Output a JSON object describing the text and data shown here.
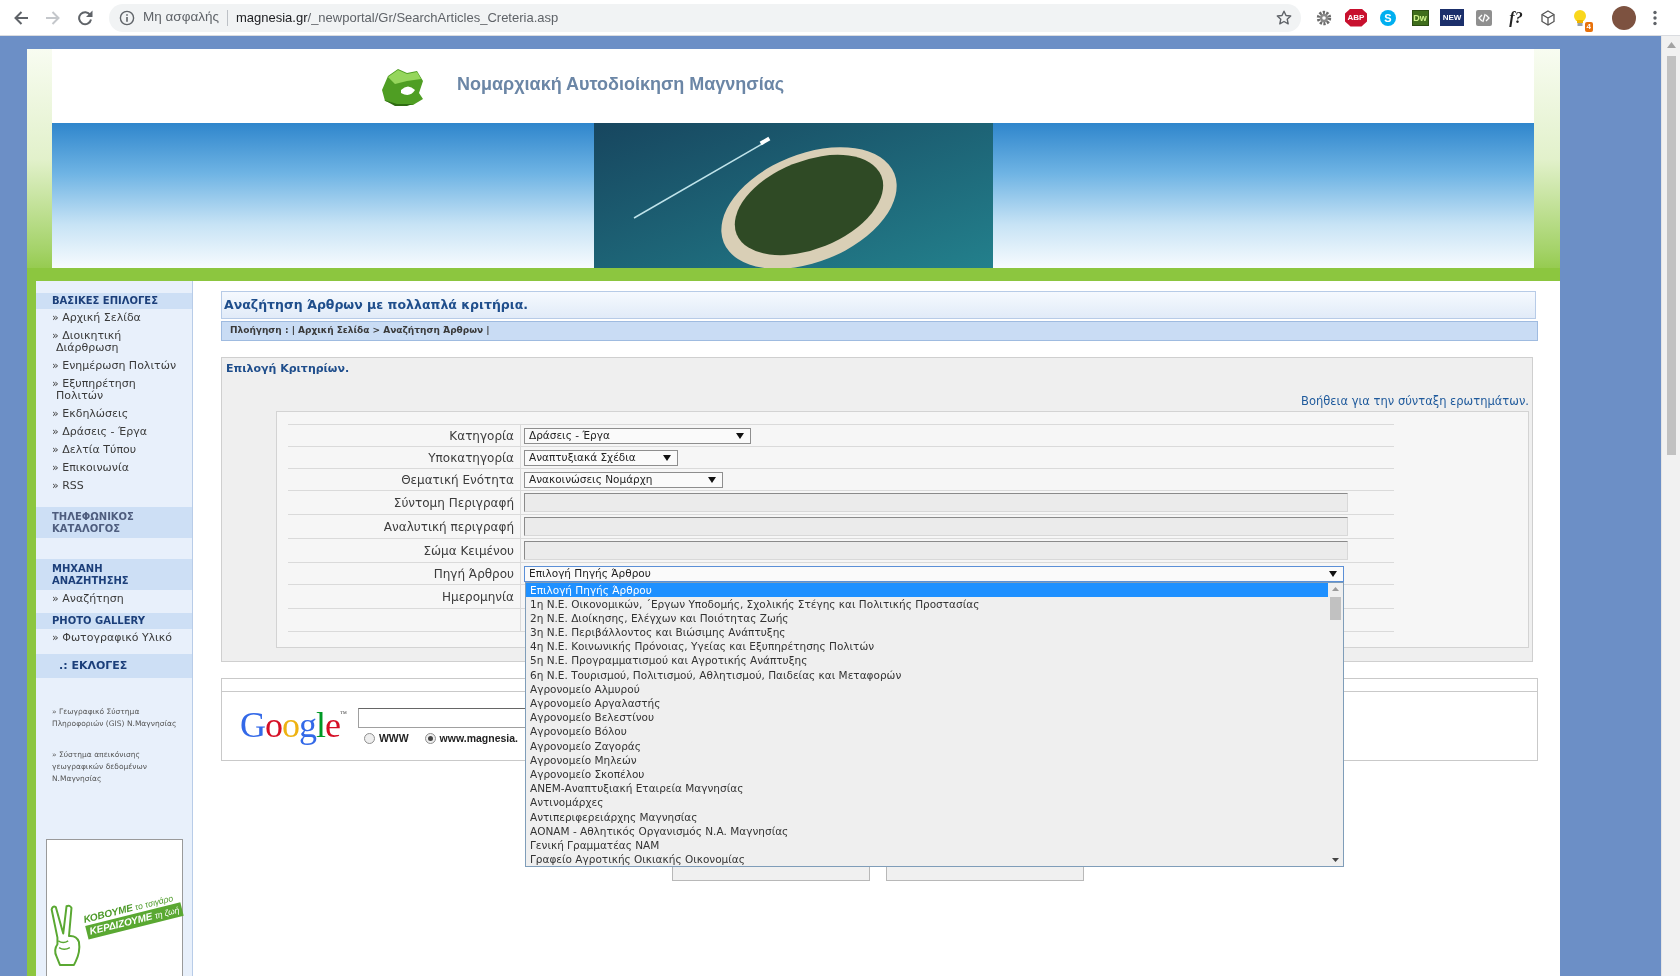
{
  "browser": {
    "nav": [
      {
        "kind": "back",
        "disabled": false
      },
      {
        "kind": "forward",
        "disabled": true
      },
      {
        "kind": "reload",
        "disabled": false
      }
    ],
    "security_label": "Μη ασφαλής",
    "url_host": "magnesia.gr",
    "url_path": "/_newportal/Gr/SearchArticles_Creteria.asp",
    "bookmarked": false,
    "extensions": [
      {
        "kind": "gear"
      },
      {
        "kind": "abp",
        "label": "ABP"
      },
      {
        "kind": "skype",
        "label": "S"
      },
      {
        "kind": "dw",
        "label": "Dw"
      },
      {
        "kind": "new",
        "label": "NEW"
      },
      {
        "kind": "code"
      },
      {
        "kind": "fq",
        "label": "f?"
      },
      {
        "kind": "cube"
      },
      {
        "kind": "bulb",
        "badge": "4"
      }
    ]
  },
  "site": {
    "title": "Νομαρχιακή Αυτοδιοίκηση Μαγνησίας"
  },
  "sidebar": {
    "sections": [
      {
        "heading": "ΒΑΣΙΚΕΣ ΕΠΙΛΟΓΕΣ",
        "items": [
          "» Αρχική Σελίδα",
          "» Διοικητική Διάρθρωση",
          "» Ενημέρωση Πολιτών",
          "» Εξυπηρέτηση Πολιτών",
          "» Εκδηλώσεις",
          "» Δράσεις - Έργα",
          "» Δελτία Τύπου",
          "» Επικοινωνία",
          "» RSS"
        ]
      },
      {
        "heading": "ΤΗΛΕΦΩΝΙΚΟΣ ΚΑΤΑΛΟΓΟΣ"
      },
      {
        "heading": "ΜΗΧΑΝΗ ΑΝΑΖΗΤΗΣΗΣ",
        "items": [
          "» Αναζήτηση"
        ]
      },
      {
        "heading": "PHOTO GALLERY",
        "items": [
          "» Φωτογραφικό Υλικό"
        ]
      },
      {
        "heading": ".: ΕΚΛΟΓΕΣ"
      }
    ],
    "external_links": [
      "» Γεωγραφικό Σύστημα Πληροφοριών (GIS) Ν.Μαγνησίας",
      "» Σύστημα απεικόνισης γεωγραφικών δεδομένων Ν.Μαγνησίας"
    ],
    "promo": {
      "line_1": "**ΚΟΒΟΥΜΕ** το τσιγάρο",
      "line_2": "**ΚΕΡΔΙΖΟΥΜΕ** τη ζωή"
    }
  },
  "main": {
    "title": "Αναζήτηση Άρθρων με πολλαπλά κριτήρια.",
    "breadcrumb": "Πλοήγηση : | Αρχική Σελίδα > Αναζήτηση Άρθρων |",
    "criteria": {
      "title": "Επιλογή Κριτηρίων.",
      "help_link": "Βοήθεια για την σύνταξη ερωτημάτων.",
      "fields": [
        {
          "label": "Κατηγορία",
          "kind": "select",
          "value": "Δράσεις - Έργα",
          "expanded": false
        },
        {
          "label": "Υποκατηγορία",
          "kind": "select",
          "value": "Αναπτυξιακά Σχέδια",
          "expanded": false
        },
        {
          "label": "Θεματική Ενότητα",
          "kind": "select",
          "value": "Ανακοινώσεις Νομάρχη",
          "expanded": false
        },
        {
          "label": "Σύντομη Περιγραφή",
          "kind": "text"
        },
        {
          "label": "Αναλυτική περιγραφή",
          "kind": "text"
        },
        {
          "label": "Σώμα Κειμένου",
          "kind": "text"
        },
        {
          "label": "Πηγή Άρθρου",
          "kind": "select",
          "value": "Επιλογή Πηγής Άρθρου",
          "expanded": true,
          "options": [
            {
              "text": "Επιλογή Πηγής Άρθρου",
              "selected": true
            },
            {
              "text": "1η Ν.Ε. Οικονομικών, ΄Εργων Υποδομής, Σχολικής Στέγης και Πολιτικής Προστασίας",
              "selected": false
            },
            {
              "text": "2η Ν.Ε. Διοίκησης, Ελέγχων και Ποιότητας Ζωής",
              "selected": false
            },
            {
              "text": "3η Ν.Ε. Περιβάλλοντος και Βιώσιμης Ανάπτυξης",
              "selected": false
            },
            {
              "text": "4η Ν.Ε. Κοινωνικής Πρόνοιας, Υγείας και Εξυπηρέτησης Πολιτών",
              "selected": false
            },
            {
              "text": "5η Ν.Ε. Προγραμματισμού και Αγροτικής Ανάπτυξης",
              "selected": false
            },
            {
              "text": "6η Ν.Ε. Τουρισμού, Πολιτισμού, Αθλητισμού, Παιδείας και Μεταφορών",
              "selected": false
            },
            {
              "text": "Αγρονομείο Αλμυρού",
              "selected": false
            },
            {
              "text": "Αγρονομείο Αργαλαστής",
              "selected": false
            },
            {
              "text": "Αγρονομείο Βελεστίνου",
              "selected": false
            },
            {
              "text": "Αγρονομείο Βόλου",
              "selected": false
            },
            {
              "text": "Αγρονομείο Ζαγοράς",
              "selected": false
            },
            {
              "text": "Αγρονομείο Μηλεών",
              "selected": false
            },
            {
              "text": "Αγρονομείο Σκοπέλου",
              "selected": false
            },
            {
              "text": "ΑΝΕΜ-Αναπτυξιακή Εταιρεία Μαγνησίας",
              "selected": false
            },
            {
              "text": "Αντινομάρχες",
              "selected": false
            },
            {
              "text": "Αντιπεριφερειάρχης Μαγνησίας",
              "selected": false
            },
            {
              "text": "ΑΟΝΑΜ - Αθλητικός Οργανισμός Ν.Α. Μαγνησίας",
              "selected": false
            },
            {
              "text": "Γενική Γραμματέας ΝΑΜ",
              "selected": false
            },
            {
              "text": "Γραφείο Αγροτικής Οικιακής Οικονομίας",
              "selected": false
            }
          ]
        },
        {
          "label": "Ημερομηνία"
        }
      ]
    },
    "google_search": {
      "logo": "Google",
      "logo_mark": "™",
      "options": [
        {
          "label": "WWW",
          "selected": false
        },
        {
          "label": "www.magnesia.",
          "selected": true
        }
      ]
    },
    "action_buttons": [
      {
        "kind": "button"
      },
      {
        "kind": "button"
      }
    ]
  }
}
